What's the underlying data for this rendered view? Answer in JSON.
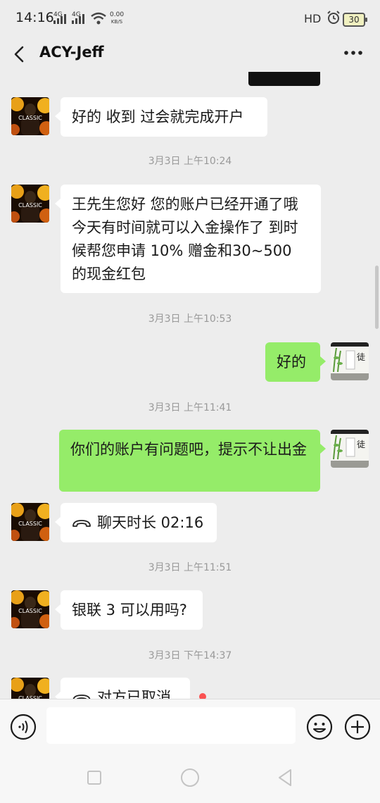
{
  "status_bar": {
    "time": "14:16",
    "net1": "4G",
    "net2": "4G",
    "speed_value": "0.00",
    "speed_unit": "KB/S",
    "hd": "HD",
    "battery": "30"
  },
  "header": {
    "title": "ACY-Jeff"
  },
  "messages": [
    {
      "type": "in",
      "text": "好的 收到 过会就完成开户"
    },
    {
      "type": "time",
      "text": "3月3日 上午10:24"
    },
    {
      "type": "in",
      "text": "王先生您好  您的账户已经开通了哦  今天有时间就可以入金操作了  到时候帮您申请 10% 赠金和30~500 的现金红包"
    },
    {
      "type": "time",
      "text": "3月3日 上午10:53"
    },
    {
      "type": "out",
      "text": "好的"
    },
    {
      "type": "time",
      "text": "3月3日 上午11:41"
    },
    {
      "type": "out",
      "text": "你们的账户有问题吧，提示不让出金"
    },
    {
      "type": "call",
      "text": "聊天时长 02:16"
    },
    {
      "type": "time",
      "text": "3月3日 上午11:51"
    },
    {
      "type": "in",
      "text": "银联 3 可以用吗?"
    },
    {
      "type": "time",
      "text": "3月3日 下午14:37"
    },
    {
      "type": "call",
      "text": "对方已取消"
    }
  ],
  "avatars": {
    "contact_text": "CLASSIC",
    "self_text": "徒"
  },
  "input": {
    "placeholder": ""
  },
  "colors": {
    "background": "#ededed",
    "bubble_in": "#ffffff",
    "bubble_out": "#95ec69",
    "timestamp": "#999999"
  }
}
